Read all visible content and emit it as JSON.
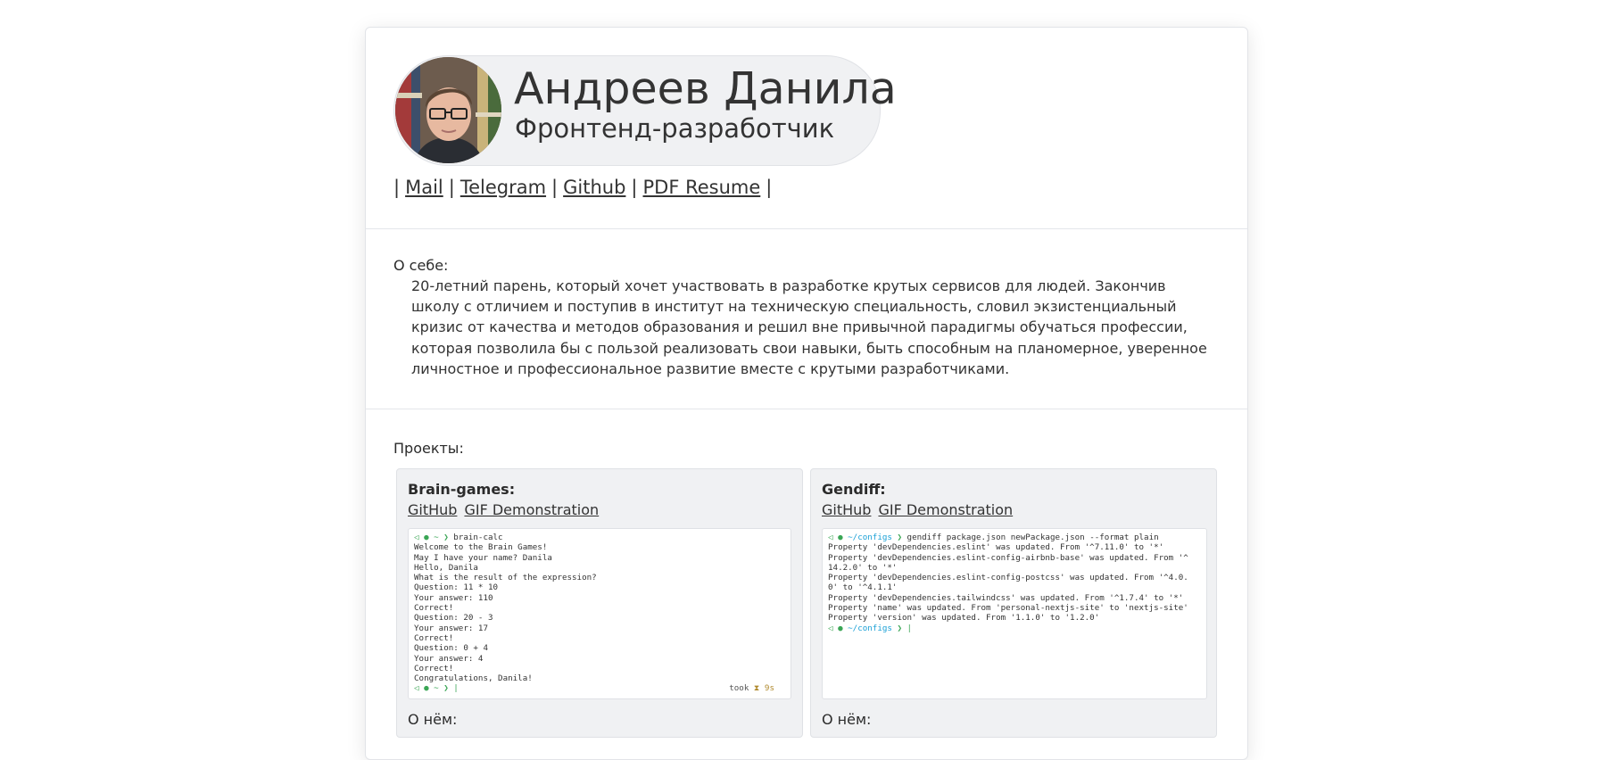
{
  "profile": {
    "name": "Андреев Данила",
    "role": "Фронтенд-разработчик",
    "avatar_icon": "person-photo-icon"
  },
  "links": {
    "separator": "|",
    "items": [
      "Mail",
      "Telegram",
      "Github",
      "PDF Resume"
    ]
  },
  "about": {
    "label": "О себе:",
    "text": "20-летний парень, который хочет участвовать в разработке крутых сервисов для людей. Закончив школу с отличием и поступив в институт на техническую специальность, словил экзистенциальный кризис от качества и методов образования и решил вне привычной парадигмы обучаться профессии, которая позволила бы с пользой реализовать свои навыки, быть способным на планомерное, уверенное личностное и профессиональное развитие вместе с крутыми разработчиками."
  },
  "projects": {
    "label": "Проекты:",
    "items": [
      {
        "title": "Brain-games:",
        "links": [
          "GitHub",
          "GIF Demonstration"
        ],
        "terminal": {
          "prompt_command": "brain-calc",
          "lines": [
            "Welcome to the Brain Games!",
            "May I have your name? Danila",
            "Hello, Danila",
            "What is the result of the expression?",
            "Question: 11 * 10",
            "Your answer: 110",
            "Correct!",
            "Question: 20 - 3",
            "Your answer: 17",
            "Correct!",
            "Question: 0 + 4",
            "Your answer: 4",
            "Correct!",
            "Congratulations, Danila!"
          ],
          "took_label": "took",
          "took_value": "9s"
        },
        "about_label": "О нём:"
      },
      {
        "title": "Gendiff:",
        "links": [
          "GitHub",
          "GIF Demonstration"
        ],
        "terminal": {
          "prompt_dir": "~/configs",
          "prompt_command": "gendiff package.json newPackage.json --format plain",
          "lines": [
            "Property 'devDependencies.eslint' was updated. From '^7.11.0' to '*'",
            "Property 'devDependencies.eslint-config-airbnb-base' was updated. From '^",
            "14.2.0' to '*'",
            "Property 'devDependencies.eslint-config-postcss' was updated. From '^4.0.",
            "0' to '^4.1.1'",
            "Property 'devDependencies.tailwindcss' was updated. From '^1.7.4' to '*'",
            "Property 'name' was updated. From 'personal-nextjs-site' to 'nextjs-site'",
            "Property 'version' was updated. From '1.1.0' to '1.2.0'"
          ]
        },
        "about_label": "О нём:"
      }
    ]
  }
}
